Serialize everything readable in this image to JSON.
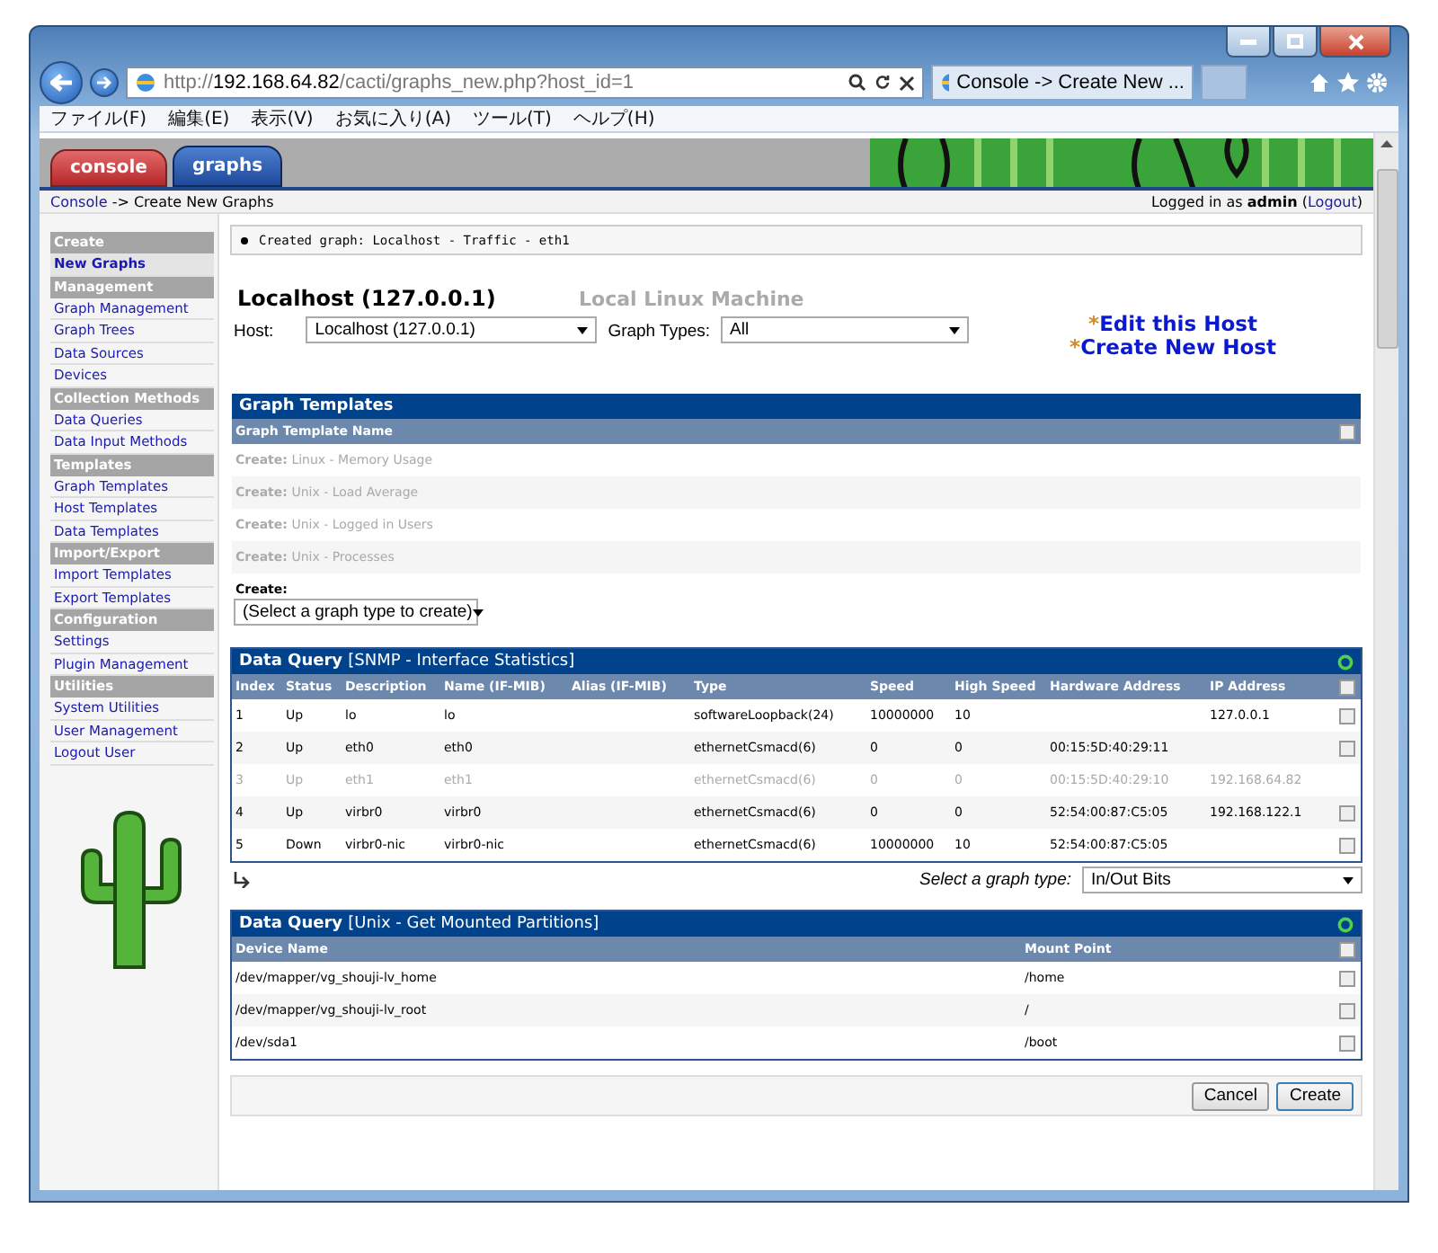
{
  "browser": {
    "address": {
      "scheme": "http://",
      "host": "192.168.64.82",
      "path": "/cacti/graphs_new.php?host_id=1"
    },
    "tab_title": "Console -> Create New ..."
  },
  "menu": [
    "ファイル(F)",
    "編集(E)",
    "表示(V)",
    "お気に入り(A)",
    "ツール(T)",
    "ヘルプ(H)"
  ],
  "app_tabs": [
    {
      "label": "console",
      "selected": false
    },
    {
      "label": "graphs",
      "selected": true
    }
  ],
  "breadcrumb": {
    "link": "Console",
    "rest": "-> Create New Graphs"
  },
  "login": {
    "text": "Logged in as",
    "user": "admin",
    "open": "(",
    "link": "Logout",
    "close": ")"
  },
  "sidebar": [
    {
      "header": "Create",
      "items": [
        {
          "label": "New Graphs",
          "selected": true
        }
      ]
    },
    {
      "header": "Management",
      "items": [
        {
          "label": "Graph Management",
          "selected": false
        },
        {
          "label": "Graph Trees",
          "selected": false
        },
        {
          "label": "Data Sources",
          "selected": false
        },
        {
          "label": "Devices",
          "selected": false
        }
      ]
    },
    {
      "header": "Collection Methods",
      "items": [
        {
          "label": "Data Queries",
          "selected": false
        },
        {
          "label": "Data Input Methods",
          "selected": false
        }
      ]
    },
    {
      "header": "Templates",
      "items": [
        {
          "label": "Graph Templates",
          "selected": false
        },
        {
          "label": "Host Templates",
          "selected": false
        },
        {
          "label": "Data Templates",
          "selected": false
        }
      ]
    },
    {
      "header": "Import/Export",
      "items": [
        {
          "label": "Import Templates",
          "selected": false
        },
        {
          "label": "Export Templates",
          "selected": false
        }
      ]
    },
    {
      "header": "Configuration",
      "items": [
        {
          "label": "Settings",
          "selected": false
        },
        {
          "label": "Plugin Management",
          "selected": false
        }
      ]
    },
    {
      "header": "Utilities",
      "items": [
        {
          "label": "System Utilities",
          "selected": false
        },
        {
          "label": "User Management",
          "selected": false
        },
        {
          "label": "Logout User",
          "selected": false
        }
      ]
    }
  ],
  "message": "Created graph: Localhost - Traffic - eth1",
  "host": {
    "name": "Localhost (127.0.0.1)",
    "description": "Local Linux Machine"
  },
  "filters": [
    {
      "label": "Host:",
      "value": "Localhost (127.0.0.1)"
    },
    {
      "label": "Graph Types:",
      "value": "All"
    }
  ],
  "host_links": [
    {
      "mark": "*",
      "label": "Edit this Host"
    },
    {
      "mark": "*",
      "label": "Create New Host"
    }
  ],
  "graph_templates": {
    "title": "Graph Templates",
    "column": "Graph Template Name",
    "select_all_checked": false,
    "rows": [
      {
        "prefix": "Create:",
        "name": "Linux - Memory Usage",
        "disabled": true
      },
      {
        "prefix": "Create:",
        "name": "Unix - Load Average",
        "disabled": true
      },
      {
        "prefix": "Create:",
        "name": "Unix - Logged in Users",
        "disabled": true
      },
      {
        "prefix": "Create:",
        "name": "Unix - Processes",
        "disabled": true
      }
    ],
    "create_label": "Create:",
    "create_select": "(Select a graph type to create)"
  },
  "data_queries": [
    {
      "title": "Data Query",
      "source": "[SNMP - Interface Statistics]",
      "columns": [
        "Index",
        "Status",
        "Description",
        "Name (IF-MIB)",
        "Alias (IF-MIB)",
        "Type",
        "Speed",
        "High Speed",
        "Hardware Address",
        "IP Address"
      ],
      "select_all_checked": false,
      "rows": [
        {
          "cells": [
            "1",
            "Up",
            "lo",
            "lo",
            "",
            "softwareLoopback(24)",
            "10000000",
            "10",
            "",
            "127.0.0.1"
          ],
          "disabled": false,
          "checked": false
        },
        {
          "cells": [
            "2",
            "Up",
            "eth0",
            "eth0",
            "",
            "ethernetCsmacd(6)",
            "0",
            "0",
            "00:15:5D:40:29:11",
            ""
          ],
          "disabled": false,
          "checked": false
        },
        {
          "cells": [
            "3",
            "Up",
            "eth1",
            "eth1",
            "",
            "ethernetCsmacd(6)",
            "0",
            "0",
            "00:15:5D:40:29:10",
            "192.168.64.82"
          ],
          "disabled": true
        },
        {
          "cells": [
            "4",
            "Up",
            "virbr0",
            "virbr0",
            "",
            "ethernetCsmacd(6)",
            "0",
            "0",
            "52:54:00:87:C5:05",
            "192.168.122.1"
          ],
          "disabled": false,
          "checked": false
        },
        {
          "cells": [
            "5",
            "Down",
            "virbr0-nic",
            "virbr0-nic",
            "",
            "ethernetCsmacd(6)",
            "10000000",
            "10",
            "52:54:00:87:C5:05",
            ""
          ],
          "disabled": false,
          "checked": false
        }
      ],
      "graph_type": {
        "label": "Select a graph type:",
        "value": "In/Out Bits"
      }
    },
    {
      "title": "Data Query",
      "source": "[Unix - Get Mounted Partitions]",
      "columns": [
        "Device Name",
        "Mount Point"
      ],
      "select_all_checked": false,
      "rows": [
        {
          "cells": [
            "/dev/mapper/vg_shouji-lv_home",
            "/home"
          ],
          "disabled": false,
          "checked": false
        },
        {
          "cells": [
            "/dev/mapper/vg_shouji-lv_root",
            "/"
          ],
          "disabled": false,
          "checked": false
        },
        {
          "cells": [
            "/dev/sda1",
            "/boot"
          ],
          "disabled": false,
          "checked": false
        }
      ]
    }
  ],
  "buttons": [
    {
      "label": "Cancel",
      "focused": false
    },
    {
      "label": "Create",
      "focused": true
    }
  ]
}
